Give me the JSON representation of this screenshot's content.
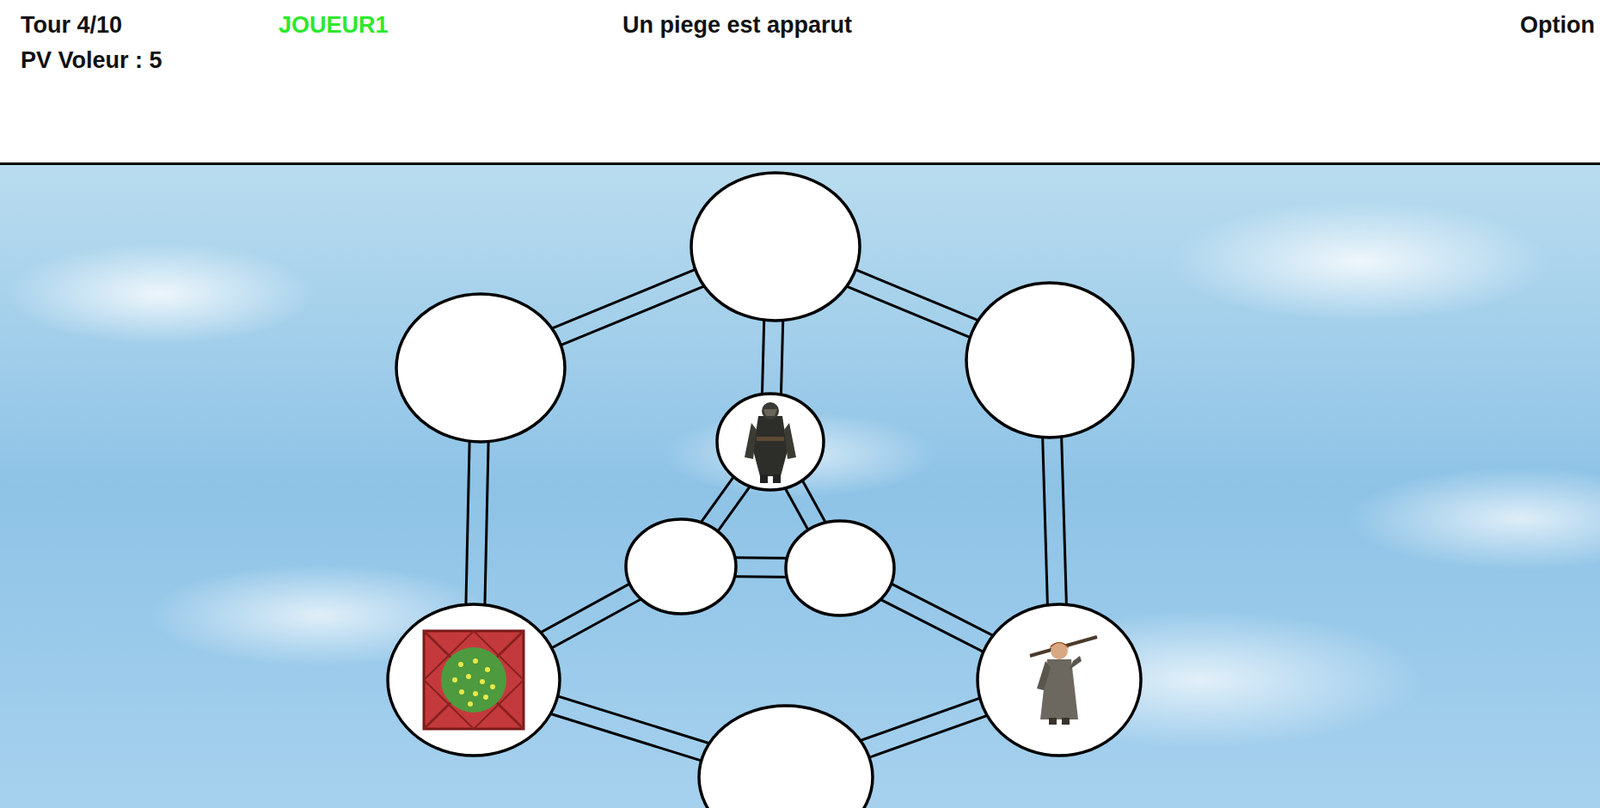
{
  "header": {
    "turn": "Tour 4/10",
    "player": "JOUEUR1",
    "message": "Un piege est apparut",
    "options": "Option",
    "thief_hp": "PV Voleur : 5"
  },
  "board": {
    "nodes": [
      {
        "kind": "empty"
      },
      {
        "kind": "empty"
      },
      {
        "kind": "empty"
      },
      {
        "kind": "thief"
      },
      {
        "kind": "empty"
      },
      {
        "kind": "empty"
      },
      {
        "kind": "trap"
      },
      {
        "kind": "guard"
      },
      {
        "kind": "empty"
      }
    ]
  }
}
